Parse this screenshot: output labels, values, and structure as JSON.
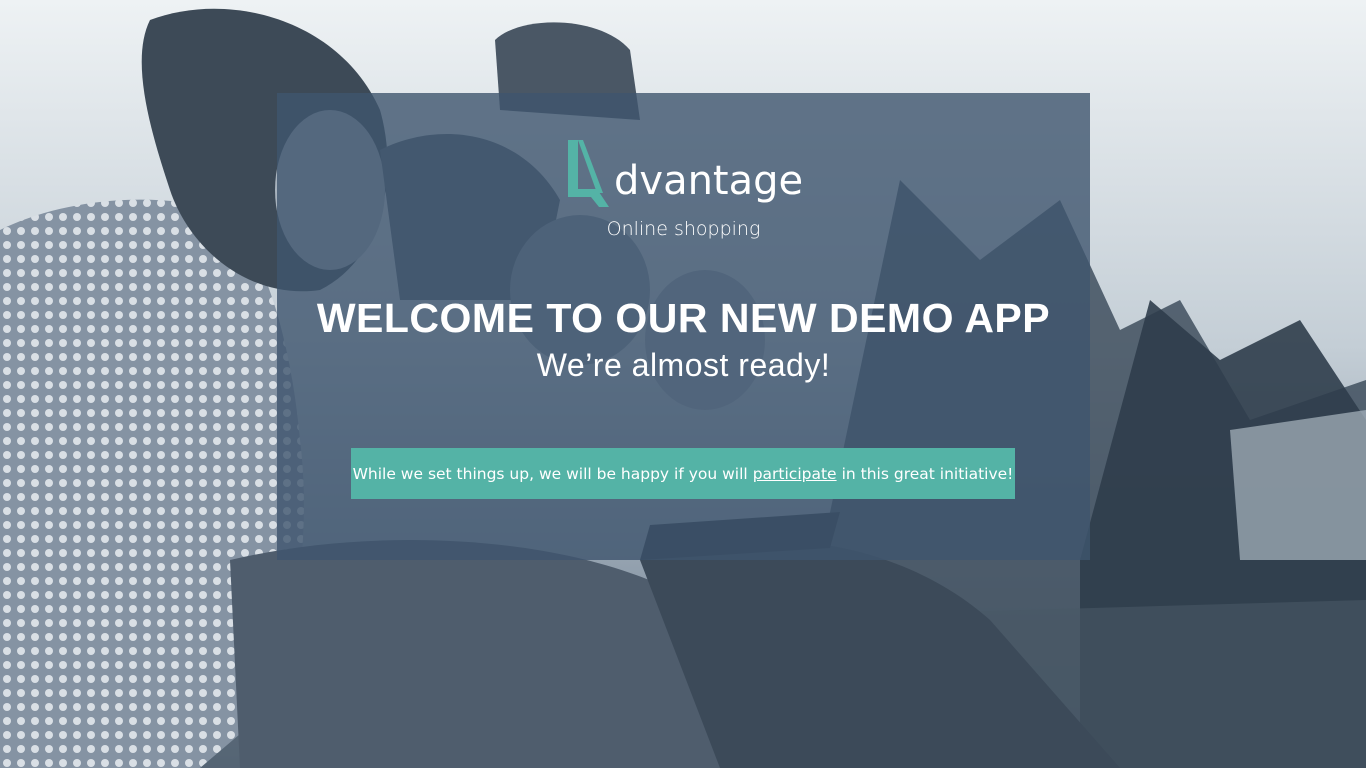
{
  "app": {
    "brand_word": "dvantage",
    "tagline": "Online shopping",
    "brand_color": "#54b3a6"
  },
  "hero": {
    "title": "WELCOME TO OUR NEW DEMO APP",
    "subtitle": "We’re almost ready!"
  },
  "banner": {
    "text_before": "While we set things up, we will be happy if you will",
    "link_label": "participate",
    "text_after": "in this great initiative!"
  },
  "icons": {
    "logo_mark": "advantage-a-logo-icon"
  }
}
